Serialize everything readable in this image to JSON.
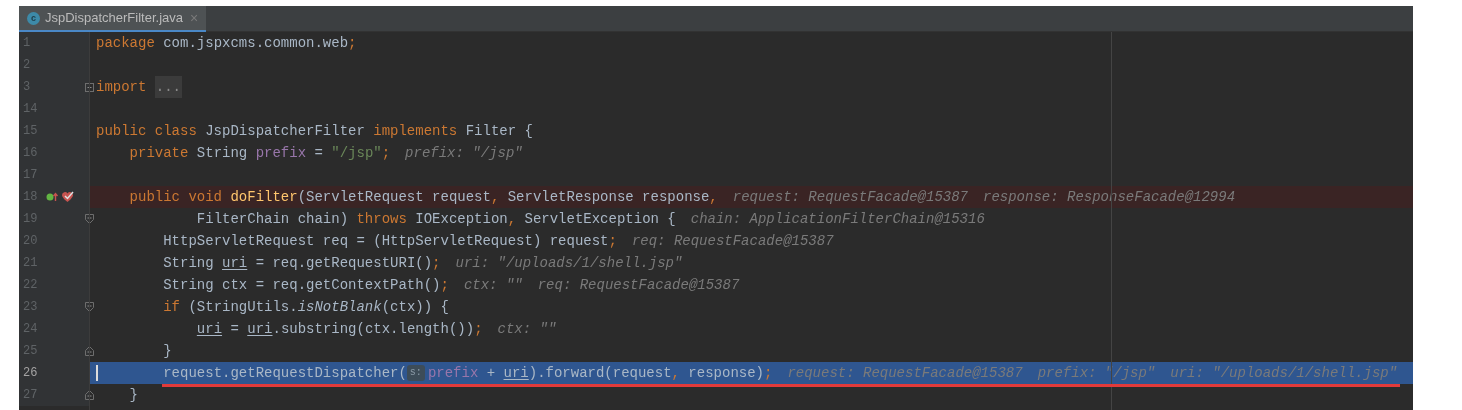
{
  "tabs": [
    {
      "title": "JspDispatcherFilter.java",
      "icon": "c",
      "close": "×",
      "selected": true
    }
  ],
  "editor": {
    "lines": [
      {
        "number": "1",
        "tokens": [
          {
            "t": "package ",
            "kind": "kw"
          },
          {
            "t": "com.jspxcms.common.web",
            "kind": "id"
          },
          {
            "t": ";",
            "kind": "p"
          }
        ]
      },
      {
        "number": "2"
      },
      {
        "number": "3",
        "folded": true,
        "tokens": [
          {
            "t": "import ",
            "kind": "kw"
          },
          {
            "t": "...",
            "kind": "fold"
          }
        ]
      },
      {
        "number": "14"
      },
      {
        "number": "15",
        "tokens": [
          {
            "t": "public class ",
            "kind": "kw"
          },
          {
            "t": "JspDispatcherFilter ",
            "kind": "id"
          },
          {
            "t": "implements ",
            "kind": "kw"
          },
          {
            "t": "Filter {",
            "kind": "id"
          }
        ]
      },
      {
        "number": "16",
        "tokens": [
          {
            "t": "    private ",
            "kind": "kw"
          },
          {
            "t": "String ",
            "kind": "id"
          },
          {
            "t": "prefix",
            "kind": "field"
          },
          {
            "t": " = ",
            "kind": "id"
          },
          {
            "t": "\"/jsp\"",
            "kind": "str"
          },
          {
            "t": ";",
            "kind": "p"
          },
          {
            "t": "prefix: \"/jsp\"",
            "kind": "hint"
          }
        ]
      },
      {
        "number": "17"
      },
      {
        "number": "18",
        "breakpoint": true,
        "tokens": [
          {
            "t": "    public void ",
            "kind": "kw"
          },
          {
            "t": "doFilter",
            "kind": "method"
          },
          {
            "t": "(ServletRequest request",
            "kind": "id"
          },
          {
            "t": ",",
            "kind": "p"
          },
          {
            "t": " ServletResponse response",
            "kind": "id"
          },
          {
            "t": ",",
            "kind": "p"
          },
          {
            "t": "request: RequestFacade@15387",
            "kind": "hint"
          },
          {
            "t": "response: ResponseFacade@12994",
            "kind": "hint"
          }
        ]
      },
      {
        "number": "19",
        "fold_start": true,
        "tokens": [
          {
            "t": "            FilterChain chain) ",
            "kind": "id"
          },
          {
            "t": "throws ",
            "kind": "kw"
          },
          {
            "t": "IOException",
            "kind": "id"
          },
          {
            "t": ",",
            "kind": "p"
          },
          {
            "t": " ServletException {",
            "kind": "id"
          },
          {
            "t": "chain: ApplicationFilterChain@15316",
            "kind": "hint"
          }
        ]
      },
      {
        "number": "20",
        "tokens": [
          {
            "t": "        HttpServletRequest req = (HttpServletRequest) request",
            "kind": "id"
          },
          {
            "t": ";",
            "kind": "p"
          },
          {
            "t": "req: RequestFacade@15387",
            "kind": "hint"
          }
        ]
      },
      {
        "number": "21",
        "tokens": [
          {
            "t": "        String ",
            "kind": "id"
          },
          {
            "t": "uri",
            "kind": "var"
          },
          {
            "t": " = req.getRequestURI()",
            "kind": "id"
          },
          {
            "t": ";",
            "kind": "p"
          },
          {
            "t": "uri: \"/uploads/1/shell.jsp\"",
            "kind": "hint"
          }
        ]
      },
      {
        "number": "22",
        "tokens": [
          {
            "t": "        String ctx = req.getContextPath()",
            "kind": "id"
          },
          {
            "t": ";",
            "kind": "p"
          },
          {
            "t": "ctx: \"\"",
            "kind": "hint"
          },
          {
            "t": "req: RequestFacade@15387",
            "kind": "hint"
          }
        ]
      },
      {
        "number": "23",
        "fold_start": true,
        "tokens": [
          {
            "t": "        if ",
            "kind": "kw"
          },
          {
            "t": "(StringUtils.",
            "kind": "id"
          },
          {
            "t": "isNotBlank",
            "kind": "static"
          },
          {
            "t": "(ctx)) {",
            "kind": "id"
          }
        ]
      },
      {
        "number": "24",
        "tokens": [
          {
            "t": "            uri",
            "kind": "var"
          },
          {
            "t": " = ",
            "kind": "id"
          },
          {
            "t": "uri",
            "kind": "var"
          },
          {
            "t": ".substring(ctx.length())",
            "kind": "id"
          },
          {
            "t": ";",
            "kind": "p"
          },
          {
            "t": "ctx: \"\"",
            "kind": "hint"
          }
        ]
      },
      {
        "number": "25",
        "fold_end": true,
        "tokens": [
          {
            "t": "        }",
            "kind": "id"
          }
        ]
      },
      {
        "number": "26",
        "current": true,
        "caret": true,
        "underline": true,
        "tokens": [
          {
            "t": "        request.getRequestDispatcher(",
            "kind": "id"
          },
          {
            "t": "s:",
            "kind": "badge"
          },
          {
            "t": "prefix",
            "kind": "field"
          },
          {
            "t": " + ",
            "kind": "id"
          },
          {
            "t": "uri",
            "kind": "var"
          },
          {
            "t": ").forward(request",
            "kind": "id"
          },
          {
            "t": ",",
            "kind": "p"
          },
          {
            "t": " response)",
            "kind": "id"
          },
          {
            "t": ";",
            "kind": "p"
          },
          {
            "t": "request: RequestFacade@15387",
            "kind": "hint"
          },
          {
            "t": "prefix: \"/jsp\"",
            "kind": "hint"
          },
          {
            "t": "uri: \"/uploads/1/shell.jsp\"",
            "kind": "hint"
          }
        ]
      },
      {
        "number": "27",
        "fold_end": true,
        "tokens": [
          {
            "t": "    }",
            "kind": "id"
          }
        ]
      }
    ]
  }
}
